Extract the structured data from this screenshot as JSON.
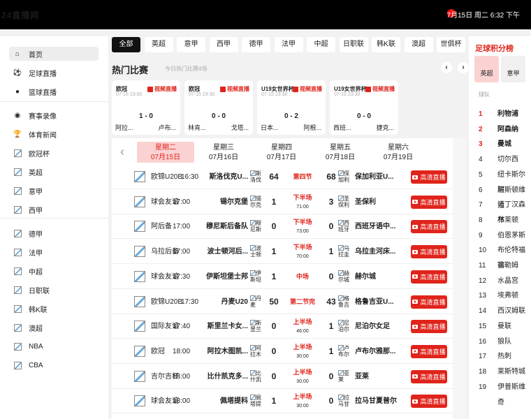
{
  "header": {
    "logo": "24直播网",
    "datetime": "7月15日 周二 6:32 下午"
  },
  "sidebar": [
    {
      "label": "首页",
      "icon": "home-icon",
      "active": true
    },
    {
      "label": "足球直播",
      "icon": "soccer-ball-icon"
    },
    {
      "label": "篮球直播",
      "icon": "basketball-icon"
    },
    {
      "label": "赛事录像",
      "icon": "video-record-icon"
    },
    {
      "label": "体育新闻",
      "icon": "trophy-icon"
    },
    {
      "label": "欧冠杯",
      "icon": "league-logo-icon"
    },
    {
      "label": "英超",
      "icon": "league-logo-icon"
    },
    {
      "label": "意甲",
      "icon": "league-logo-icon"
    },
    {
      "label": "西甲",
      "icon": "league-logo-icon"
    },
    {
      "label": "德甲",
      "icon": "league-logo-icon"
    },
    {
      "label": "法甲",
      "icon": "league-logo-icon"
    },
    {
      "label": "中超",
      "icon": "league-logo-icon"
    },
    {
      "label": "日职联",
      "icon": "league-logo-icon"
    },
    {
      "label": "韩K联",
      "icon": "league-logo-icon"
    },
    {
      "label": "澳超",
      "icon": "league-logo-icon"
    },
    {
      "label": "NBA",
      "icon": "league-logo-icon"
    },
    {
      "label": "CBA",
      "icon": "league-logo-icon"
    }
  ],
  "tabs": [
    "全部",
    "英超",
    "意甲",
    "西甲",
    "德甲",
    "法甲",
    "中超",
    "日职联",
    "韩K联",
    "澳超",
    "世俱杯"
  ],
  "hot": {
    "title": "热门比赛",
    "subtitle": "今日热门比赛4场",
    "prev": "‹",
    "next": "›"
  },
  "cards": [
    {
      "league": "欧冠",
      "time": "07-15 23:00",
      "live": "视频直播",
      "score": "1 - 0",
      "home": "阿拉...",
      "away": "卢布..."
    },
    {
      "league": "欧冠",
      "time": "07-15 23:30",
      "live": "视频直播",
      "score": "0 - 0",
      "home": "林肯...",
      "away": "戈塔..."
    },
    {
      "league": "U19女世界杯",
      "time": "07-15 23:30",
      "live": "视频直播",
      "score": "0 - 2",
      "home": "日本...",
      "away": "阿根..."
    },
    {
      "league": "U19女世界杯",
      "time": "07-15 23:30",
      "live": "视频直播",
      "score": "0 - 0",
      "home": "西班...",
      "away": "捷克..."
    }
  ],
  "days": [
    {
      "name": "星期二",
      "date": "07月15日",
      "selected": true
    },
    {
      "name": "星期三",
      "date": "07月16日"
    },
    {
      "name": "星期四",
      "date": "07月17日"
    },
    {
      "name": "星期五",
      "date": "07月18日"
    },
    {
      "name": "星期六",
      "date": "07月19日"
    }
  ],
  "matches": [
    {
      "league": "欧锦U20B",
      "time": "16:30",
      "home": "斯洛伐克U...",
      "home_logo": "斯洛伐",
      "hs": "64",
      "status": "第四节",
      "status_sub": "",
      "status_color": "#e0241b",
      "as": "68",
      "away_logo": "保加利",
      "away": "保加利亚U...",
      "btn": "高清直播"
    },
    {
      "league": "球会友谊",
      "time": "17:00",
      "home": "锡尔克堡",
      "home_logo": "锡尔克",
      "hs": "1",
      "status": "下半场",
      "status_sub": "71:00",
      "status_color": "#e0241b",
      "as": "3",
      "away_logo": "圣保利",
      "away": "圣保利",
      "btn": "高清直播"
    },
    {
      "league": "阿后备",
      "time": "17:00",
      "home": "穆尼斯后备队",
      "home_logo": "穆尼斯",
      "hs": "0",
      "status": "下半场",
      "status_sub": "73:00",
      "status_color": "#e0241b",
      "as": "0",
      "away_logo": "西班牙",
      "away": "西班牙语中...",
      "btn": "高清直播"
    },
    {
      "league": "乌拉后备",
      "time": "17:00",
      "home": "波士顿河后...",
      "home_logo": "波士顿",
      "hs": "1",
      "status": "下半场",
      "status_sub": "70:00",
      "status_color": "#e0241b",
      "as": "1",
      "away_logo": "乌拉圭",
      "away": "乌拉圭河床...",
      "btn": "高清直播"
    },
    {
      "league": "球会友谊",
      "time": "17:30",
      "home": "伊斯坦堡士邦",
      "home_logo": "伊斯坦",
      "hs": "1",
      "status": "中场",
      "status_sub": "",
      "status_color": "#e0241b",
      "as": "0",
      "away_logo": "赫尔城",
      "away": "赫尔城",
      "btn": "高清直播"
    },
    {
      "league": "欧锦U20B",
      "time": "17:30",
      "home": "丹麦U20",
      "home_logo": "丹麦",
      "hs": "50",
      "status": "第二节完",
      "status_sub": "",
      "status_color": "#e0241b",
      "as": "43",
      "away_logo": "格鲁吉",
      "away": "格鲁吉亚U...",
      "btn": "高清直播"
    },
    {
      "league": "国际友谊",
      "time": "17:40",
      "home": "斯里兰卡女...",
      "home_logo": "斯里兰",
      "hs": "0",
      "status": "上半场",
      "status_sub": "46:00",
      "status_color": "#e0241b",
      "as": "1",
      "away_logo": "尼泊尔",
      "away": "尼泊尔女足",
      "btn": "高清直播"
    },
    {
      "league": "欧冠",
      "time": "18:00",
      "home": "阿拉木图凯...",
      "home_logo": "阿拉木",
      "hs": "0",
      "status": "上半场",
      "status_sub": "30:00",
      "status_color": "#e0241b",
      "as": "1",
      "away_logo": "卢布尔",
      "away": "卢布尔雅那...",
      "btn": "高清直播"
    },
    {
      "league": "吉尔吉杯",
      "time": "18:00",
      "home": "比什凯克多...",
      "home_logo": "比什凯",
      "hs": "0",
      "status": "上半场",
      "status_sub": "30:00",
      "status_color": "#e0241b",
      "as": "0",
      "away_logo": "亚莱",
      "away": "亚莱",
      "btn": "高清直播"
    },
    {
      "league": "球会友谊",
      "time": "18:00",
      "home": "佩塔提科",
      "home_logo": "佩塔提",
      "hs": "1",
      "status": "上半场",
      "status_sub": "30:00",
      "status_color": "#e0241b",
      "as": "0",
      "away_logo": "拉马甘",
      "away": "拉马甘夏普尔",
      "btn": "高清直播"
    }
  ],
  "standings": {
    "title": "足球积分榜",
    "tabs": [
      "英超",
      "意甲"
    ],
    "header": "球队",
    "rows": [
      {
        "rank": "1",
        "team": "利物浦"
      },
      {
        "rank": "2",
        "team": "阿森纳"
      },
      {
        "rank": "3",
        "team": "曼城"
      },
      {
        "rank": "4",
        "team": "切尔西"
      },
      {
        "rank": "5",
        "team": "纽卡斯尔联"
      },
      {
        "rank": "6",
        "team": "阿斯顿维拉"
      },
      {
        "rank": "7",
        "team": "诺丁汉森林"
      },
      {
        "rank": "8",
        "team": "布莱顿"
      },
      {
        "rank": "9",
        "team": "伯恩茅斯"
      },
      {
        "rank": "10",
        "team": "布伦特福德"
      },
      {
        "rank": "11",
        "team": "富勒姆"
      },
      {
        "rank": "12",
        "team": "水晶宫"
      },
      {
        "rank": "13",
        "team": "埃弗顿"
      },
      {
        "rank": "14",
        "team": "西汉姆联"
      },
      {
        "rank": "15",
        "team": "曼联"
      },
      {
        "rank": "16",
        "team": "狼队"
      },
      {
        "rank": "17",
        "team": "热刺"
      },
      {
        "rank": "18",
        "team": "莱斯特城"
      },
      {
        "rank": "19",
        "team": "伊普斯维奇"
      }
    ]
  },
  "colors": {
    "accent": "#e0241b",
    "selected_bg": "#fbd2d2"
  }
}
